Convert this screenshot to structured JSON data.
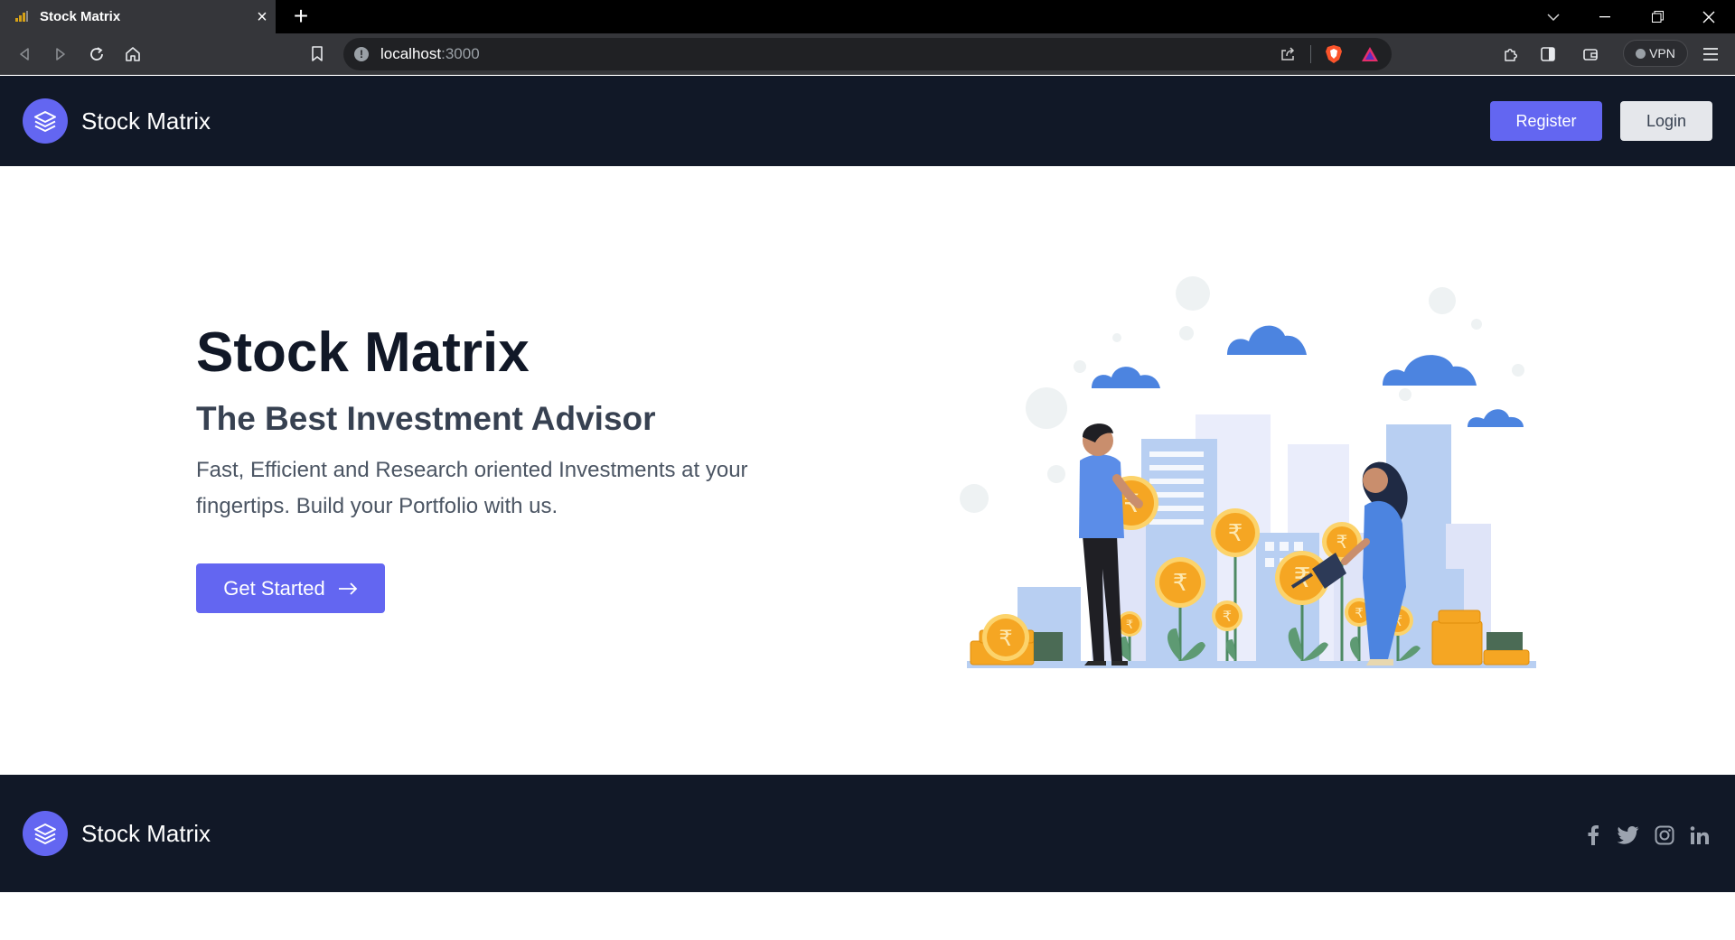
{
  "browser": {
    "tab_title": "Stock Matrix",
    "url_host": "localhost",
    "url_port": ":3000",
    "vpn_label": "VPN"
  },
  "header": {
    "brand": "Stock Matrix",
    "register_label": "Register",
    "login_label": "Login"
  },
  "hero": {
    "title": "Stock Matrix",
    "subtitle": "The Best Investment Advisor",
    "description": "Fast, Efficient and Research oriented Investments at your fingertips. Build your Portfolio with us.",
    "cta_label": "Get Started"
  },
  "footer": {
    "brand": "Stock Matrix",
    "social": [
      "facebook-icon",
      "twitter-icon",
      "instagram-icon",
      "linkedin-icon"
    ]
  },
  "colors": {
    "accent": "#6366f1",
    "dark": "#111827",
    "coin": "#f5a623",
    "cloud": "#4c84e0"
  }
}
